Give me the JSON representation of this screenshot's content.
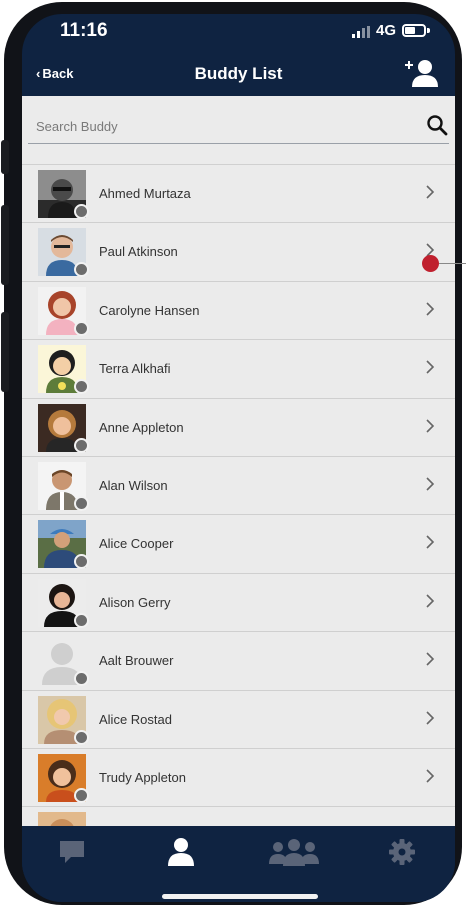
{
  "status_bar": {
    "time": "11:16",
    "network": "4G"
  },
  "nav": {
    "back_label": "Back",
    "title": "Buddy List",
    "add_icon": "add-user-icon"
  },
  "search": {
    "placeholder": "Search Buddy",
    "value": "",
    "icon": "search-icon"
  },
  "buddies": [
    {
      "name": "Ahmed Murtaza",
      "status": "offline"
    },
    {
      "name": "Paul Atkinson",
      "status": "offline"
    },
    {
      "name": "Carolyne Hansen",
      "status": "offline"
    },
    {
      "name": "Terra Alkhafi",
      "status": "offline"
    },
    {
      "name": "Anne Appleton",
      "status": "offline"
    },
    {
      "name": "Alan Wilson",
      "status": "offline"
    },
    {
      "name": "Alice Cooper",
      "status": "offline"
    },
    {
      "name": "Alison Gerry",
      "status": "offline"
    },
    {
      "name": "Aalt Brouwer",
      "status": "offline"
    },
    {
      "name": "Alice Rostad",
      "status": "offline"
    },
    {
      "name": "Trudy Appleton",
      "status": "offline"
    },
    {
      "name": "",
      "status": "offline"
    }
  ],
  "tabs": [
    {
      "icon": "chat-icon",
      "active": false
    },
    {
      "icon": "buddy-icon",
      "active": true
    },
    {
      "icon": "group-icon",
      "active": false
    },
    {
      "icon": "settings-icon",
      "active": false
    }
  ],
  "colors": {
    "header_bg": "#0f2341",
    "content_bg": "#ebebeb",
    "tab_inactive": "#5a6478",
    "tab_active": "#ffffff",
    "status_offline": "#6c6c6c",
    "annotation": "#c0202e"
  }
}
